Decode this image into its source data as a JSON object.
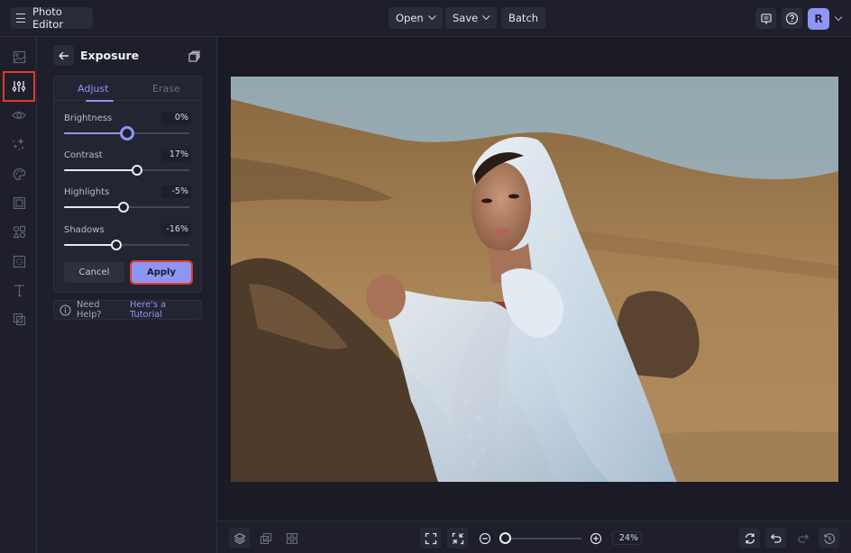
{
  "topbar": {
    "app_title": "Photo Editor",
    "menu": [
      {
        "label": "Open",
        "has_dropdown": true
      },
      {
        "label": "Save",
        "has_dropdown": true
      },
      {
        "label": "Batch",
        "has_dropdown": false
      }
    ],
    "icons": [
      "feedback-icon",
      "help-icon"
    ],
    "avatar_initial": "R"
  },
  "rail": {
    "items": [
      {
        "name": "image",
        "icon": "image-icon",
        "active": false
      },
      {
        "name": "adjust",
        "icon": "sliders-icon",
        "active": true
      },
      {
        "name": "view",
        "icon": "eye-icon",
        "active": false
      },
      {
        "name": "effects",
        "icon": "sparkle-icon",
        "active": false
      },
      {
        "name": "artsy",
        "icon": "palette-icon",
        "active": false
      },
      {
        "name": "frames",
        "icon": "frame-icon",
        "active": false
      },
      {
        "name": "graphics",
        "icon": "shapes-icon",
        "active": false
      },
      {
        "name": "textures",
        "icon": "texture-icon",
        "active": false
      },
      {
        "name": "text",
        "icon": "text-icon",
        "active": false
      },
      {
        "name": "overlays",
        "icon": "overlay-icon",
        "active": false
      }
    ]
  },
  "panel": {
    "title": "Exposure",
    "tabs": [
      {
        "label": "Adjust",
        "active": true
      },
      {
        "label": "Erase",
        "active": false
      }
    ],
    "sliders": [
      {
        "label": "Brightness",
        "value": 0,
        "display": "0%",
        "min": -100,
        "max": 100,
        "active": true
      },
      {
        "label": "Contrast",
        "value": 17,
        "display": "17%",
        "min": -100,
        "max": 100,
        "active": false
      },
      {
        "label": "Highlights",
        "value": -5,
        "display": "-5%",
        "min": -100,
        "max": 100,
        "active": false
      },
      {
        "label": "Shadows",
        "value": -16,
        "display": "-16%",
        "min": -100,
        "max": 100,
        "active": false
      }
    ],
    "cancel_label": "Cancel",
    "apply_label": "Apply",
    "help_text": "Need Help?",
    "help_link": "Here's a Tutorial"
  },
  "bottombar": {
    "zoom_value": "24%",
    "zoom_fraction": 0.0
  },
  "colors": {
    "accent": "#8d96f5",
    "highlight_outline": "#e03a2b",
    "background": "#1e1f2a"
  }
}
